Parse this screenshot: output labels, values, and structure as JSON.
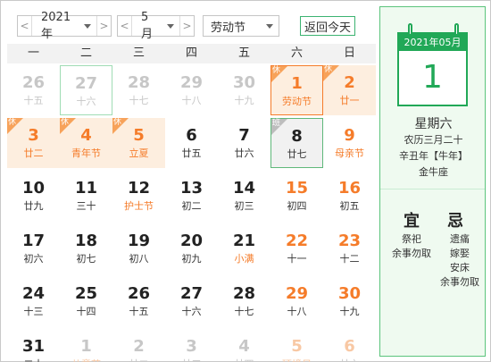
{
  "toolbar": {
    "prev_arrow": "<",
    "next_arrow": ">",
    "year": "2021年",
    "month": "5月",
    "holiday": "劳动节",
    "today_button": "返回今天"
  },
  "weekdays": [
    "一",
    "二",
    "三",
    "四",
    "五",
    "六",
    "日"
  ],
  "weeks": [
    [
      {
        "d": "26",
        "l": "十五",
        "other": true
      },
      {
        "d": "27",
        "l": "十六",
        "other": true,
        "hover": true
      },
      {
        "d": "28",
        "l": "十七",
        "other": true
      },
      {
        "d": "29",
        "l": "十八",
        "other": true
      },
      {
        "d": "30",
        "l": "十九",
        "other": true
      },
      {
        "d": "1",
        "l": "劳动节",
        "holiday": true,
        "badge": "休",
        "selected": true,
        "weekend": true
      },
      {
        "d": "2",
        "l": "廿一",
        "holiday": true,
        "badge": "休",
        "weekend": true
      }
    ],
    [
      {
        "d": "3",
        "l": "廿二",
        "holiday": true,
        "badge": "休"
      },
      {
        "d": "4",
        "l": "青年节",
        "holiday": true,
        "badge": "休"
      },
      {
        "d": "5",
        "l": "立夏",
        "holiday": true,
        "badge": "休"
      },
      {
        "d": "6",
        "l": "廿五"
      },
      {
        "d": "7",
        "l": "廿六"
      },
      {
        "d": "8",
        "l": "廿七",
        "work": true,
        "badge": "班"
      },
      {
        "d": "9",
        "l": "母亲节",
        "weekend": true,
        "fest": true
      }
    ],
    [
      {
        "d": "10",
        "l": "廿九"
      },
      {
        "d": "11",
        "l": "三十"
      },
      {
        "d": "12",
        "l": "护士节",
        "fest": true
      },
      {
        "d": "13",
        "l": "初二"
      },
      {
        "d": "14",
        "l": "初三"
      },
      {
        "d": "15",
        "l": "初四",
        "weekend": true
      },
      {
        "d": "16",
        "l": "初五",
        "weekend": true
      }
    ],
    [
      {
        "d": "17",
        "l": "初六"
      },
      {
        "d": "18",
        "l": "初七"
      },
      {
        "d": "19",
        "l": "初八"
      },
      {
        "d": "20",
        "l": "初九"
      },
      {
        "d": "21",
        "l": "小满",
        "fest": true
      },
      {
        "d": "22",
        "l": "十一",
        "weekend": true
      },
      {
        "d": "23",
        "l": "十二",
        "weekend": true
      }
    ],
    [
      {
        "d": "24",
        "l": "十三"
      },
      {
        "d": "25",
        "l": "十四"
      },
      {
        "d": "26",
        "l": "十五"
      },
      {
        "d": "27",
        "l": "十六"
      },
      {
        "d": "28",
        "l": "十七"
      },
      {
        "d": "29",
        "l": "十八",
        "weekend": true
      },
      {
        "d": "30",
        "l": "十九",
        "weekend": true
      }
    ],
    [
      {
        "d": "31",
        "l": "二十"
      },
      {
        "d": "1",
        "l": "儿童节",
        "other": true,
        "fest": true
      },
      {
        "d": "2",
        "l": "廿二",
        "other": true
      },
      {
        "d": "3",
        "l": "廿三",
        "other": true
      },
      {
        "d": "4",
        "l": "廿四",
        "other": true
      },
      {
        "d": "5",
        "l": "环境日",
        "other": true,
        "weekend": true,
        "fest": true
      },
      {
        "d": "6",
        "l": "廿六",
        "other": true,
        "weekend": true
      }
    ]
  ],
  "panel": {
    "header": "2021年05月",
    "day": "1",
    "weekday": "星期六",
    "lunar": "农历三月二十",
    "ganzhi": "辛丑年【牛年】",
    "constellation": "金牛座",
    "yi_title": "宜",
    "ji_title": "忌",
    "yi_items": [
      "祭祀",
      "余事勿取"
    ],
    "ji_items": [
      "遗痛",
      "嫁娶",
      "安床",
      "余事勿取"
    ]
  },
  "colors": {
    "accent_green": "#21a857",
    "holiday_orange": "#f57c2a",
    "holiday_bg": "#fdeedf"
  }
}
